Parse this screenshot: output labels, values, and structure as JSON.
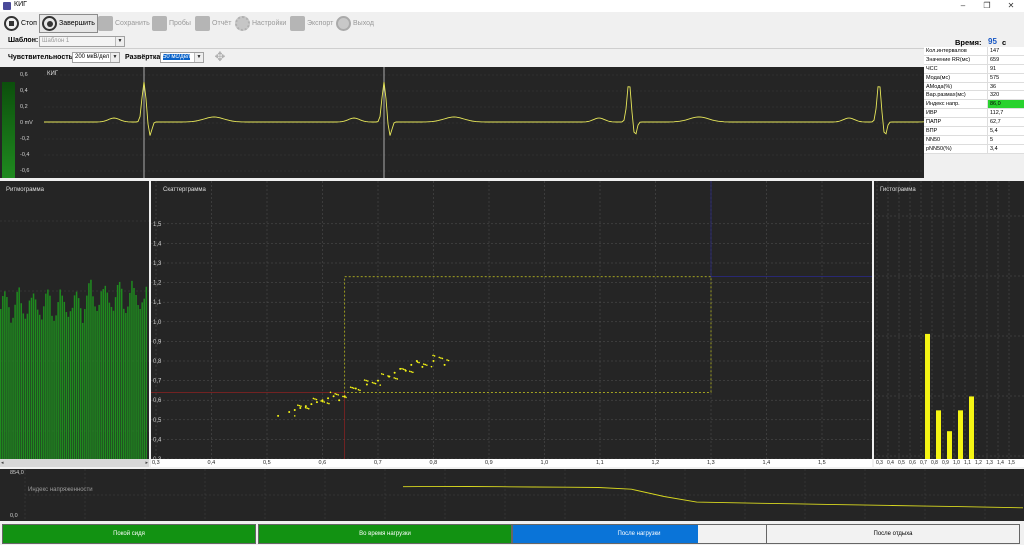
{
  "window": {
    "title": "КИГ"
  },
  "toolbar": {
    "stop": "Стоп",
    "finish": "Завершить",
    "save": "Сохранить",
    "samples": "Пробы",
    "report": "Отчёт",
    "settings": "Настройки",
    "export": "Экспорт",
    "exit": "Выход"
  },
  "template": {
    "label": "Шаблон:",
    "value": "Шаблон 1"
  },
  "controls": {
    "sensitivity_label": "Чувствительность",
    "sensitivity_value": "200 мкВ/дел",
    "sweep_label": "Развёртка",
    "sweep_value": "50 мс/дел"
  },
  "timer": {
    "label": "Время:",
    "value": "95",
    "unit": "с"
  },
  "parameters": [
    {
      "name": "Кол.интервалов",
      "value": "147"
    },
    {
      "name": "Значение RR(мс)",
      "value": "659"
    },
    {
      "name": "ЧСС",
      "value": "91"
    },
    {
      "name": "Мода(мс)",
      "value": "575"
    },
    {
      "name": "АМода(%)",
      "value": "36"
    },
    {
      "name": "Вар.размах(мс)",
      "value": "320"
    },
    {
      "name": "Индекс напр.",
      "value": "86,0",
      "highlight": "#29d22e"
    },
    {
      "name": "ИВР",
      "value": "112,7"
    },
    {
      "name": "ПАПР",
      "value": "62,7"
    },
    {
      "name": "ВПР",
      "value": "5,4"
    },
    {
      "name": "NN50",
      "value": "5"
    },
    {
      "name": "pNN50(%)",
      "value": "3,4"
    }
  ],
  "ecg": {
    "label": "КИГ",
    "y_ticks": [
      "0,6",
      "0,4",
      "0,2",
      "0 mV",
      "-0,2",
      "-0,4",
      "-0,6"
    ],
    "r_peaks_ms": [
      100,
      340,
      585,
      835
    ],
    "color": "#e8e85a"
  },
  "rhythmogram": {
    "label": "Ритмограмма",
    "bar_color": "#1f8a1f"
  },
  "scatter": {
    "label": "Скаттерграмма",
    "y_ticks": [
      "1,5",
      "1,4",
      "1,3",
      "1,2",
      "1,1",
      "1,0",
      "0,9",
      "0,8",
      "0,7",
      "0,6",
      "0,5",
      "0,4",
      "0,3"
    ],
    "x_ticks": [
      "0,3",
      "0,4",
      "0,5",
      "0,6",
      "0,7",
      "0,8",
      "0,9",
      "1,0",
      "1,1",
      "1,2",
      "1,3",
      "1,4",
      "1,5"
    ],
    "point_color": "#f5f514"
  },
  "histogram": {
    "label": "Гистограмма",
    "x_ticks": [
      "0,3",
      "0,4",
      "0,5",
      "0,6",
      "0,7",
      "0,8",
      "0,9",
      "1,0",
      "1,1",
      "1,2",
      "1,3",
      "1,4",
      "1,5"
    ],
    "bar_color": "#f5f514"
  },
  "stress_index": {
    "label": "Индекс напряженности",
    "y_max": "854,0",
    "y_min": "0,0",
    "line_color": "#d8d820"
  },
  "stages": [
    {
      "label": "Покой сидя",
      "color": "#129212"
    },
    {
      "label": "Во время нагрузки",
      "color": "#129212"
    },
    {
      "label": "После нагрузки",
      "color": "#0a74d8"
    },
    {
      "label": "После отдыха",
      "color": "#f2f2f2"
    }
  ],
  "chart_data": [
    {
      "type": "line",
      "title": "КИГ",
      "y_range": [
        -0.6,
        0.6
      ],
      "y_unit": "mV",
      "series": [
        {
          "values": [
            0,
            0.15,
            -0.05,
            0,
            0.15,
            -0.05,
            0,
            0.15,
            -0.05,
            0,
            0.15,
            -0.05
          ]
        }
      ]
    },
    {
      "type": "scatter",
      "title": "Скаттерграмма",
      "x_range": [
        0.3,
        1.55
      ],
      "y_range": [
        0.3,
        1.55
      ],
      "x": [
        0.52,
        0.54,
        0.55,
        0.56,
        0.57,
        0.58,
        0.59,
        0.6,
        0.61,
        0.62,
        0.63,
        0.64,
        0.66,
        0.68,
        0.7,
        0.72,
        0.73,
        0.74,
        0.75,
        0.76,
        0.77,
        0.78,
        0.8,
        0.82
      ],
      "y": [
        0.52,
        0.54,
        0.55,
        0.56,
        0.57,
        0.58,
        0.59,
        0.6,
        0.61,
        0.62,
        0.6,
        0.62,
        0.66,
        0.68,
        0.7,
        0.72,
        0.74,
        0.76,
        0.75,
        0.78,
        0.8,
        0.77,
        0.8,
        0.78
      ]
    },
    {
      "type": "bar",
      "title": "Гистограмма",
      "categories": [
        "0,3",
        "0,4",
        "0,5",
        "0,6",
        "0,7",
        "0,8",
        "0,9",
        "1,0",
        "1,1",
        "1,2",
        "1,3",
        "1,4",
        "1,5"
      ],
      "values": [
        0,
        0,
        36,
        14,
        8,
        14,
        18,
        0,
        0,
        0,
        0,
        0,
        0
      ],
      "ylim": [
        0,
        80
      ]
    },
    {
      "type": "line",
      "title": "Индекс напряженности",
      "y_range": [
        0,
        854
      ],
      "series": [
        {
          "values": [
            575,
            580,
            578,
            575,
            570,
            565,
            560,
            530,
            400,
            300,
            290,
            280,
            270,
            260,
            250,
            240,
            230,
            220,
            210,
            200
          ]
        }
      ]
    }
  ]
}
